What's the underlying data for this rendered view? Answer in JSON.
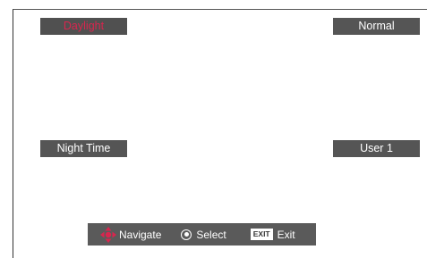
{
  "modes": {
    "daylight": "Daylight",
    "normal": "Normal",
    "night_time": "Night Time",
    "user1": "User 1",
    "selected": "Daylight"
  },
  "hints": {
    "navigate": "Navigate",
    "select": "Select",
    "exit_key": "EXIT",
    "exit": "Exit"
  },
  "colors": {
    "selected_text": "#d9254e",
    "button_bg": "#555555",
    "nav_arrows": "#d9254e"
  }
}
